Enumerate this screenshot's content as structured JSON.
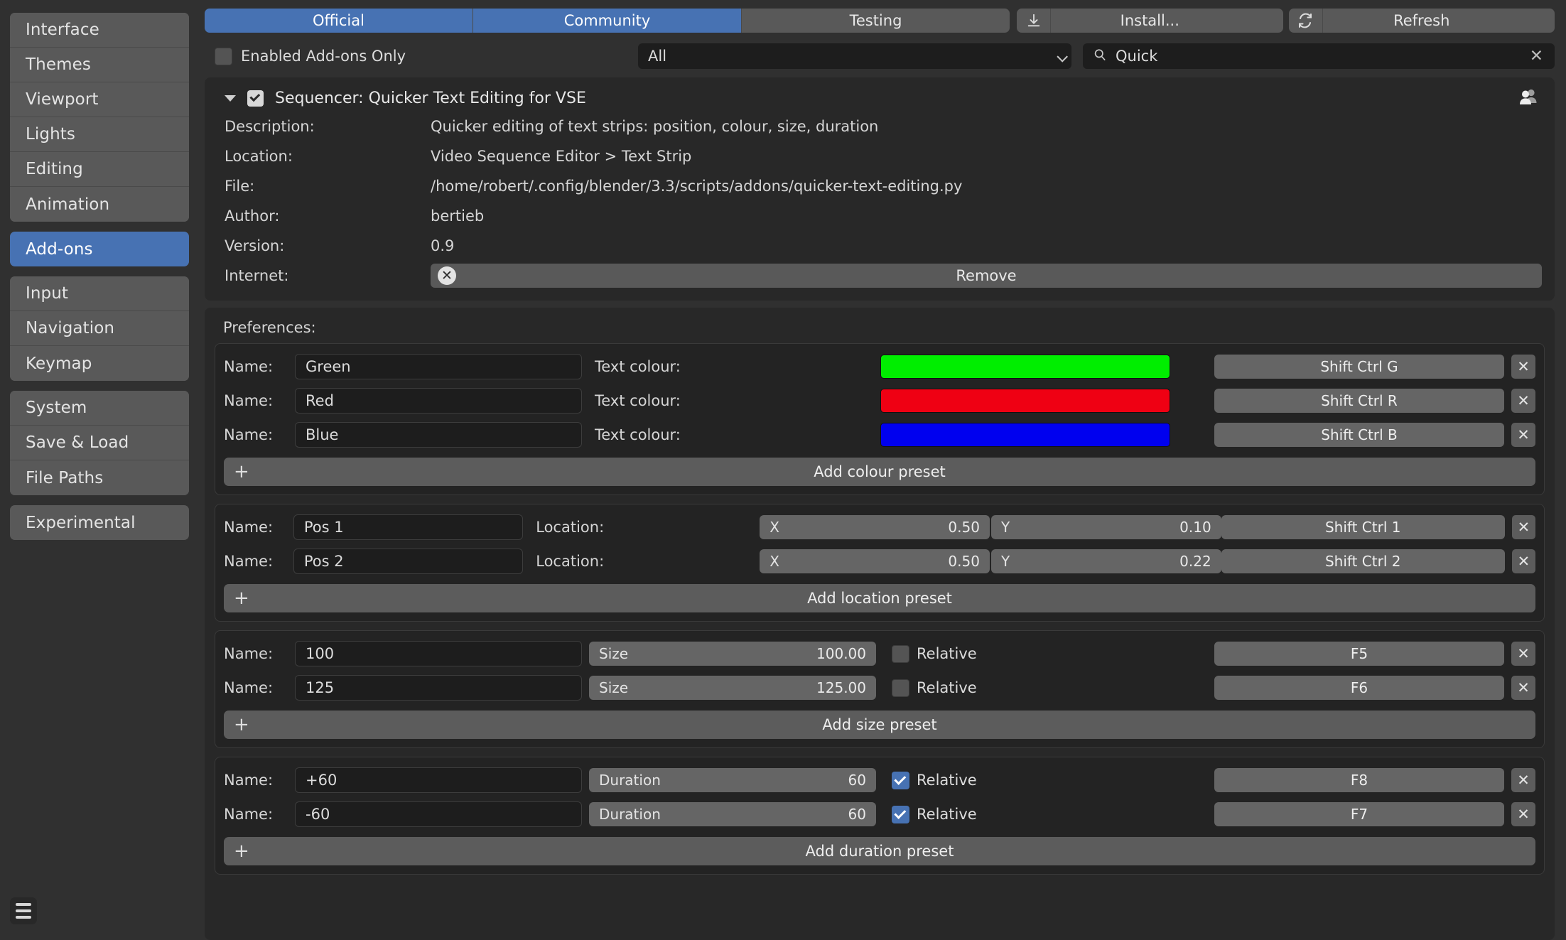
{
  "sidebar": {
    "groups": [
      {
        "items": [
          {
            "label": "Interface",
            "selected": false
          },
          {
            "label": "Themes",
            "selected": false
          },
          {
            "label": "Viewport",
            "selected": false
          },
          {
            "label": "Lights",
            "selected": false
          },
          {
            "label": "Editing",
            "selected": false
          },
          {
            "label": "Animation",
            "selected": false
          }
        ]
      },
      {
        "items": [
          {
            "label": "Add-ons",
            "selected": true
          }
        ]
      },
      {
        "items": [
          {
            "label": "Input",
            "selected": false
          },
          {
            "label": "Navigation",
            "selected": false
          },
          {
            "label": "Keymap",
            "selected": false
          }
        ]
      },
      {
        "items": [
          {
            "label": "System",
            "selected": false
          },
          {
            "label": "Save & Load",
            "selected": false
          },
          {
            "label": "File Paths",
            "selected": false
          }
        ]
      },
      {
        "items": [
          {
            "label": "Experimental",
            "selected": false
          }
        ]
      }
    ],
    "menu_icon": "hamburger-menu-icon"
  },
  "toolbar": {
    "tabs": [
      {
        "label": "Official",
        "active": true
      },
      {
        "label": "Community",
        "active": true
      },
      {
        "label": "Testing",
        "active": false
      }
    ],
    "install_label": "Install...",
    "install_icon": "download-icon",
    "refresh_label": "Refresh",
    "refresh_icon": "refresh-icon",
    "accent_color": "#4772b3"
  },
  "filterbar": {
    "enabled_only_label": "Enabled Add-ons Only",
    "enabled_only_checked": false,
    "category_value": "All",
    "category_icon": "chevron-down-icon",
    "search_value": "Quick",
    "search_placeholder": "Search",
    "search_icon": "search-icon",
    "clear_icon": "close-icon"
  },
  "addon": {
    "expanded": true,
    "enabled": true,
    "title": "Sequencer: Quicker Text Editing for VSE",
    "support_icon": "community-users-icon",
    "fields": [
      {
        "key": "Description:",
        "value": "Quicker editing of text strips: position, colour, size, duration"
      },
      {
        "key": "Location:",
        "value": "Video Sequence Editor > Text Strip"
      },
      {
        "key": "File:",
        "value": "/home/robert/.config/blender/3.3/scripts/addons/quicker-text-editing.py"
      },
      {
        "key": "Author:",
        "value": "bertieb"
      },
      {
        "key": "Version:",
        "value": "0.9"
      }
    ],
    "internet_key": "Internet:",
    "remove_label": "Remove",
    "remove_icon": "cancel-circle-icon"
  },
  "preferences": {
    "title": "Preferences:",
    "name_label": "Name:",
    "colour_group": {
      "mid_label": "Text colour:",
      "rows": [
        {
          "name": "Green",
          "color": "#00ee00",
          "shortcut": "Shift Ctrl G"
        },
        {
          "name": "Red",
          "color": "#ef0013",
          "shortcut": "Shift Ctrl R"
        },
        {
          "name": "Blue",
          "color": "#0000ef",
          "shortcut": "Shift Ctrl B"
        }
      ],
      "add_label": "Add colour preset"
    },
    "location_group": {
      "mid_label": "Location:",
      "x_label": "X",
      "y_label": "Y",
      "rows": [
        {
          "name": "Pos 1",
          "x": "0.50",
          "y": "0.10",
          "shortcut": "Shift Ctrl 1"
        },
        {
          "name": "Pos 2",
          "x": "0.50",
          "y": "0.22",
          "shortcut": "Shift Ctrl 2"
        }
      ],
      "add_label": "Add location preset"
    },
    "size_group": {
      "value_label": "Size",
      "relative_label": "Relative",
      "rows": [
        {
          "name": "100",
          "value": "100.00",
          "relative": false,
          "shortcut": "F5"
        },
        {
          "name": "125",
          "value": "125.00",
          "relative": false,
          "shortcut": "F6"
        }
      ],
      "add_label": "Add size preset"
    },
    "duration_group": {
      "value_label": "Duration",
      "relative_label": "Relative",
      "rows": [
        {
          "name": "+60",
          "value": "60",
          "relative": true,
          "shortcut": "F8"
        },
        {
          "name": "-60",
          "value": "60",
          "relative": true,
          "shortcut": "F7"
        }
      ],
      "add_label": "Add duration preset"
    },
    "remove_row_icon": "close-icon",
    "add_icon": "plus-icon"
  }
}
